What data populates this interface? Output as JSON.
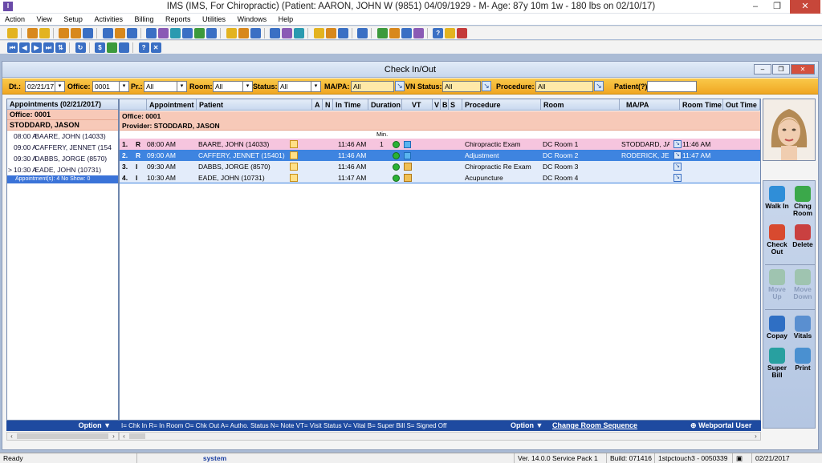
{
  "window": {
    "title": "IMS (IMS, For Chiropractic)     (Patient: AARON, JOHN W (9851) 04/09/1929 - M- Age: 87y 10m 1w - 180 lbs on 02/10/17)"
  },
  "menu": [
    "Action",
    "View",
    "Setup",
    "Activities",
    "Billing",
    "Reports",
    "Utilities",
    "Windows",
    "Help"
  ],
  "child": {
    "title": "Check In/Out"
  },
  "filters": {
    "dt_label": "Dt.:",
    "dt_value": "02/21/17",
    "office_label": "Office:",
    "office_value": "0001",
    "pr_label": "Pr.:",
    "pr_value": "All",
    "room_label": "Room:",
    "room_value": "All",
    "status_label": "Status:",
    "status_value": "All",
    "mapa_label": "MA/PA:",
    "mapa_value": "All",
    "vn_label": "VN Status:",
    "vn_value": "All",
    "procedure_label": "Procedure:",
    "procedure_value": "All",
    "patient_label": "Patient(?)",
    "patient_value": ""
  },
  "left": {
    "header": "Appointments (02/21/2017)",
    "office": "Office: 0001",
    "provider": "STODDARD, JASON",
    "appts": [
      {
        "time": "08:00 A",
        "name": "BAARE, JOHN (14033)",
        "marker": ""
      },
      {
        "time": "09:00 A",
        "name": "CAFFERY, JENNET (154",
        "marker": ""
      },
      {
        "time": "09:30 A",
        "name": "DABBS, JORGE (8570)",
        "marker": ""
      },
      {
        "time": "10:30 A",
        "name": "EADE, JOHN (10731)",
        "marker": ">"
      }
    ],
    "count": "Appointment(s): 4   No Show: 0",
    "option": "Option ▼"
  },
  "grid": {
    "headers": [
      "Appointment",
      "Patient",
      "A",
      "N",
      "In Time",
      "Duration",
      "VT",
      "V",
      "B",
      "S",
      "Procedure",
      "Room",
      "MA/PA",
      "Room Time",
      "Out Time"
    ],
    "office": "Office: 0001",
    "provider": "Provider: STODDARD, JASON",
    "min_label": "Min.",
    "rows": [
      {
        "num": "1.",
        "st": "R",
        "time": "08:00 AM",
        "patient": "BAARE, JOHN (14033)",
        "in": "11:46 AM",
        "dur": "1",
        "proc": "Chiropractic Exam",
        "room": "DC Room 1",
        "mapa": "STODDARD, JA",
        "roomtime": "11:46 AM"
      },
      {
        "num": "2.",
        "st": "R",
        "time": "09:00 AM",
        "patient": "CAFFERY, JENNET (15401)",
        "in": "11:46 AM",
        "dur": "",
        "proc": "Adjustment",
        "room": "DC Room 2",
        "mapa": "RODERICK, JEF",
        "roomtime": "11:47 AM"
      },
      {
        "num": "3.",
        "st": "I",
        "time": "09:30 AM",
        "patient": "DABBS, JORGE (8570)",
        "in": "11:46 AM",
        "dur": "",
        "proc": "Chiropractic Re Exam",
        "room": "DC Room 3",
        "mapa": "",
        "roomtime": ""
      },
      {
        "num": "4.",
        "st": "I",
        "time": "10:30 AM",
        "patient": "EADE, JOHN (10731)",
        "in": "11:47 AM",
        "dur": "",
        "proc": "Acupuncture",
        "room": "DC Room 4",
        "mapa": "",
        "roomtime": ""
      }
    ],
    "legend": "I= Chk In  R= In Room O= Chk Out  A= Autho. Status  N= Note  VT= Visit Status  V= Vital  B= Super Bill  S= Signed Off",
    "option": "Option ▼",
    "change_room": "Change Room Sequence",
    "webportal": "Webportal User"
  },
  "actions": {
    "walkin": "Walk In",
    "chngroom": "Chng Room",
    "checkout": "Check Out",
    "delete": "Delete",
    "moveup": "Move Up",
    "movedown": "Move Down",
    "copay": "Copay",
    "vitals": "Vitals",
    "superbill": "Super Bill",
    "print": "Print"
  },
  "status": {
    "ready": "Ready",
    "user": "system",
    "version": "Ver. 14.0.0 Service Pack 1",
    "build": "Build: 071416",
    "machine": "1stpctouch3 - 0050339",
    "date": "02/21/2017"
  }
}
